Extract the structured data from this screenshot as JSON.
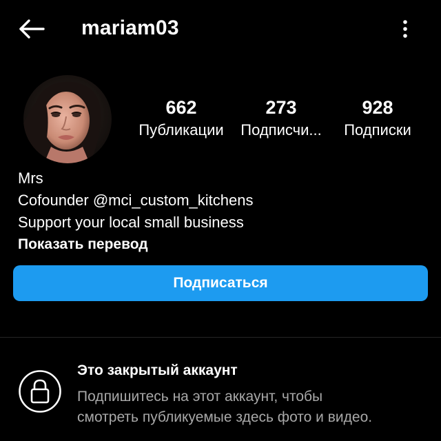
{
  "header": {
    "username": "mariam03",
    "back_icon": "arrow-left-icon",
    "more_icon": "vertical-dots-icon"
  },
  "profile": {
    "avatar": "profile-photo",
    "stats": [
      {
        "count": "662",
        "label": "Публикации"
      },
      {
        "count": "273",
        "label": "Подписчи..."
      },
      {
        "count": "928",
        "label": "Подписки"
      }
    ],
    "bio": {
      "name": "Mrs",
      "line1": "Cofounder @mci_custom_kitchens",
      "line2": "Support your local small business",
      "translate_link": "Показать перевод"
    },
    "follow_button": "Подписаться"
  },
  "private_notice": {
    "icon": "lock-icon",
    "title": "Это закрытый аккаунт",
    "description_line1": "Подпишитесь на этот аккаунт, чтобы",
    "description_line2": "смотреть публикуемые здесь фото и видео."
  },
  "colors": {
    "background": "#000000",
    "accent": "#1d9bf0",
    "secondary_text": "#a8a8a8",
    "divider": "#262626"
  }
}
